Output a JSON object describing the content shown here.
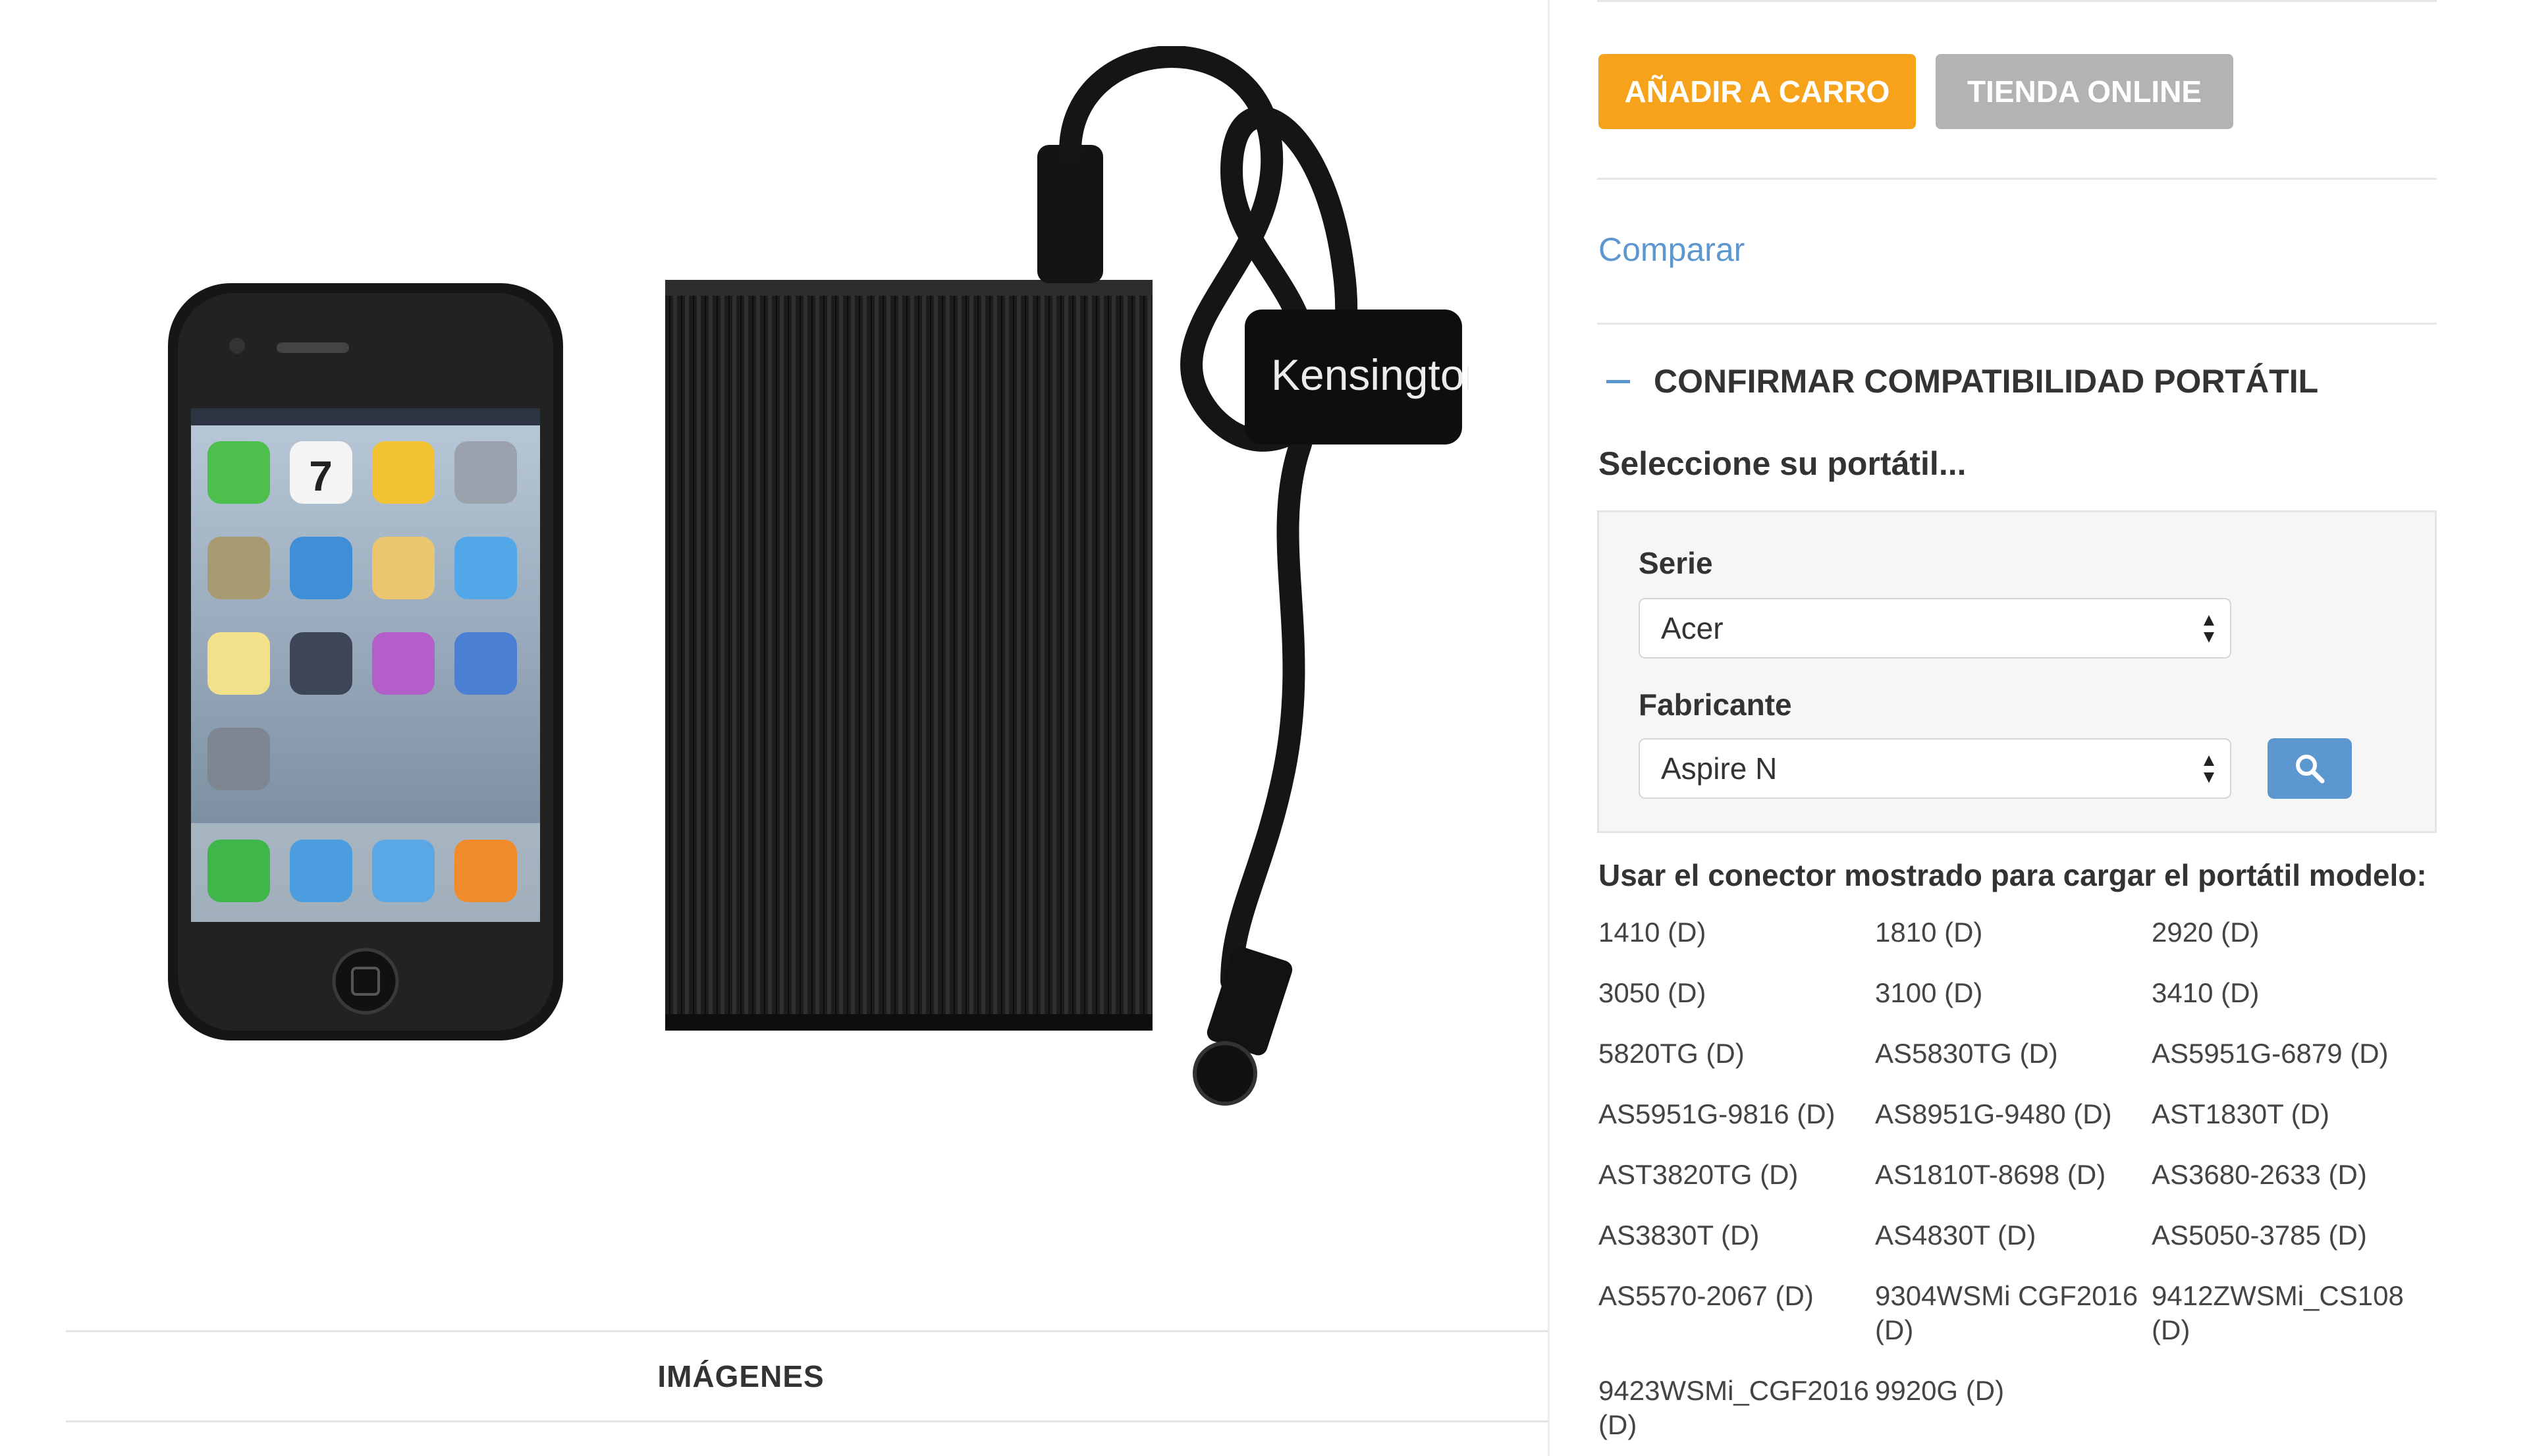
{
  "actions": {
    "add_to_cart": "AÑADIR A CARRO",
    "online_store": "TIENDA ONLINE",
    "compare": "Comparar"
  },
  "compatibility": {
    "title": "CONFIRMAR COMPATIBILIDAD PORTÁTIL",
    "select_title": "Seleccione su portátil...",
    "series_label": "Serie",
    "series_value": "Acer",
    "manufacturer_label": "Fabricante",
    "manufacturer_value": "Aspire N",
    "usage_text": "Usar el conector mostrado para cargar el portátil modelo:"
  },
  "models": [
    "1410 (D)",
    "1810 (D)",
    "2920 (D)",
    "3050 (D)",
    "3100 (D)",
    "3410 (D)",
    "5820TG (D)",
    "AS5830TG (D)",
    "AS5951G-6879 (D)",
    "AS5951G-9816 (D)",
    "AS8951G-9480 (D)",
    "AST1830T (D)",
    "AST3820TG (D)",
    "AS1810T-8698 (D)",
    "AS3680-2633 (D)",
    "AS3830T (D)",
    "AS4830T (D)",
    "AS5050-3785 (D)",
    "AS5570-2067 (D)",
    "9304WSMi CGF2016 (D)",
    "9412ZWSMi_CS108 (D)",
    "9423WSMi_CGF2016 (D)",
    "9920G (D)"
  ],
  "gallery": {
    "tab_label": "IMÁGENES",
    "strap_brand": "Kensington",
    "phone_date": "7"
  },
  "colors": {
    "accent_orange": "#f7a21b",
    "accent_blue": "#5d97d0",
    "disabled_gray": "#b3b3b3"
  }
}
